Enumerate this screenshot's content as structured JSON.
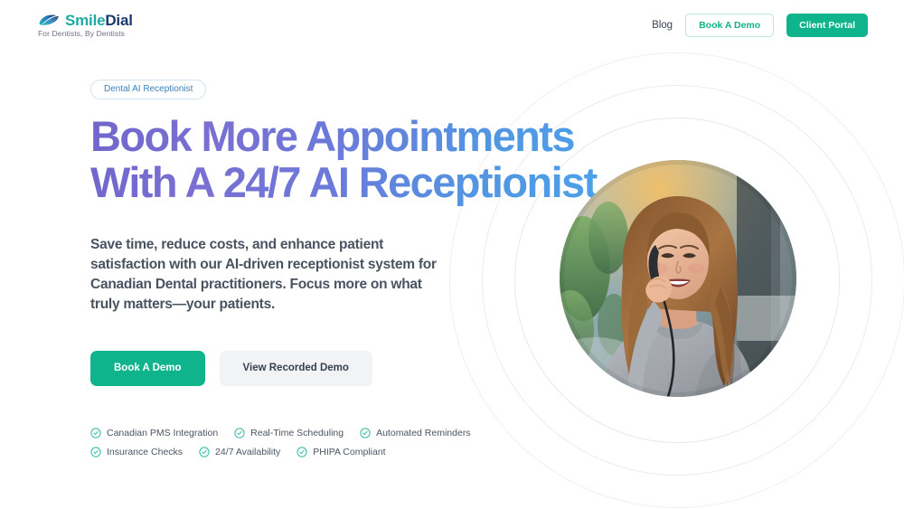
{
  "brand": {
    "mark_icon": "smile-swoosh-icon",
    "name_part_1": "Smile",
    "name_part_2": "Dial",
    "tagline": "For Dentists, By Dentists",
    "color_teal": "#22a9a0",
    "color_navy": "#1b3a6b"
  },
  "header": {
    "nav_link_blog": "Blog",
    "btn_book_demo": "Book A Demo",
    "btn_client_portal": "Client Portal"
  },
  "hero": {
    "badge": "Dental AI Receptionist",
    "headline_line_1": "Book More Appointments",
    "headline_line_2": "With A 24/7 AI Receptionist",
    "headline_gradient_from": "#7166cc",
    "headline_gradient_to": "#4aa3ea",
    "subcopy": "Save time, reduce costs, and enhance patient satisfaction with our AI-driven receptionist system for Canadian Dental practitioners. Focus more on what truly matters—your patients.",
    "cta_primary": "Book A Demo",
    "cta_secondary": "View Recorded Demo",
    "cta_primary_color": "#0fb48c",
    "features_row_1": [
      "Canadian PMS Integration",
      "Real-Time Scheduling",
      "Automated Reminders"
    ],
    "features_row_2": [
      "Insurance Checks",
      "24/7 Availability",
      "PHIPA Compliant"
    ],
    "feature_icon": "check-circle-icon",
    "feature_icon_color": "#2bb9a0",
    "photo_alt": "smiling-receptionist-on-phone-photo",
    "decor": "concentric-rings"
  }
}
